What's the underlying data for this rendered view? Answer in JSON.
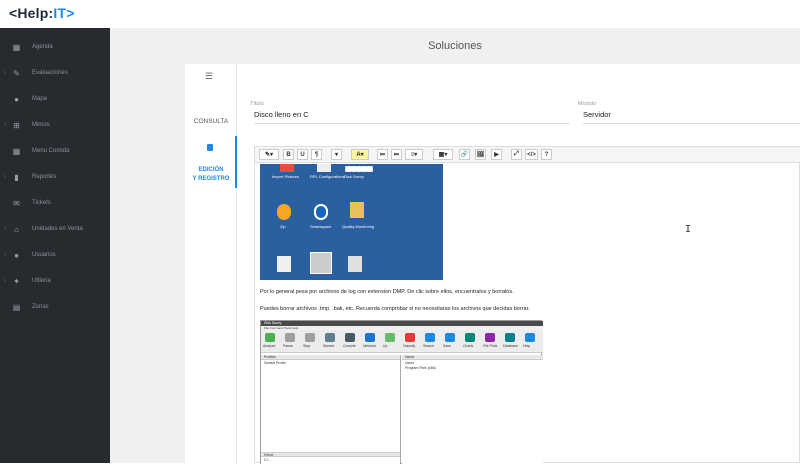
{
  "app": {
    "logo_prefix": "<Help",
    "logo_sep": ":",
    "logo_suffix": "IT>",
    "accent": "#1e88e5"
  },
  "sidebar": {
    "items": [
      {
        "label": "Agenda",
        "icon": "calendar-icon",
        "caret": false
      },
      {
        "label": "Evaluaciones",
        "icon": "edit-icon",
        "caret": true
      },
      {
        "label": "Mapa",
        "icon": "map-pin-icon",
        "caret": false
      },
      {
        "label": "Mimos",
        "icon": "plus-square-icon",
        "caret": true
      },
      {
        "label": "Menu Comida",
        "icon": "calendar-icon",
        "caret": false
      },
      {
        "label": "Reportes",
        "icon": "bar-chart-icon",
        "caret": true
      },
      {
        "label": "Tickets",
        "icon": "envelope-icon",
        "caret": false
      },
      {
        "label": "Unidades en Venta",
        "icon": "home-icon",
        "caret": true
      },
      {
        "label": "Usuarios",
        "icon": "user-icon",
        "caret": true
      },
      {
        "label": "Utileria",
        "icon": "wrench-icon",
        "caret": true
      },
      {
        "label": "Zonas",
        "icon": "grid-icon",
        "caret": false
      }
    ]
  },
  "page": {
    "title": "Soluciones"
  },
  "tabs": {
    "consulta": "CONSULTA",
    "edicion_line1": "EDICIÓN",
    "edicion_line2": "Y REGISTRO"
  },
  "form": {
    "titulo_label": "Título",
    "titulo_value": "Disco lleno en C",
    "modulo_label": "Modulo",
    "modulo_value": "Servidor"
  },
  "editor": {
    "toolbar": [
      "✎▾",
      "B",
      "U",
      "¶",
      "▾",
      "A▾",
      "≔",
      "≔",
      "≡▾",
      "▦▾",
      "🔗",
      "🖼",
      "▶",
      "⤢",
      "</>",
      "?"
    ],
    "paragraph1": "Por lo general pesa por archivos de log con extension DMP. De clic sobre ellos, encuentralos y borralos.",
    "paragraph2": "Puedes borrar archivos .tmp, .bak, etc. Recuerda comprobar si no necesitaras los archivos que decidas borrar.",
    "desktop_labels": [
      "Import Pictures",
      "RPL Configurations",
      "Disk Savvy",
      "Zip",
      "Smartspace",
      "Quality Monitoring",
      "",
      "",
      ""
    ],
    "app_window": {
      "title": "Disk Savvy",
      "menu": "File  Command  Tools  Help",
      "buttons": [
        "Analyze",
        "Pause",
        "Stop",
        "Wizard",
        "Console",
        "Network",
        "Up",
        "Classify",
        "Search",
        "Save",
        "Charts",
        "File Plots",
        "Database",
        "Help"
      ],
      "left_header": "Profiles",
      "left_row": "Default Profile",
      "right_header": "Name",
      "right_rows": [
        "Users",
        "Program Files (x86)"
      ],
      "bottom_header": "Home",
      "bottom_row": "C:\\"
    }
  }
}
